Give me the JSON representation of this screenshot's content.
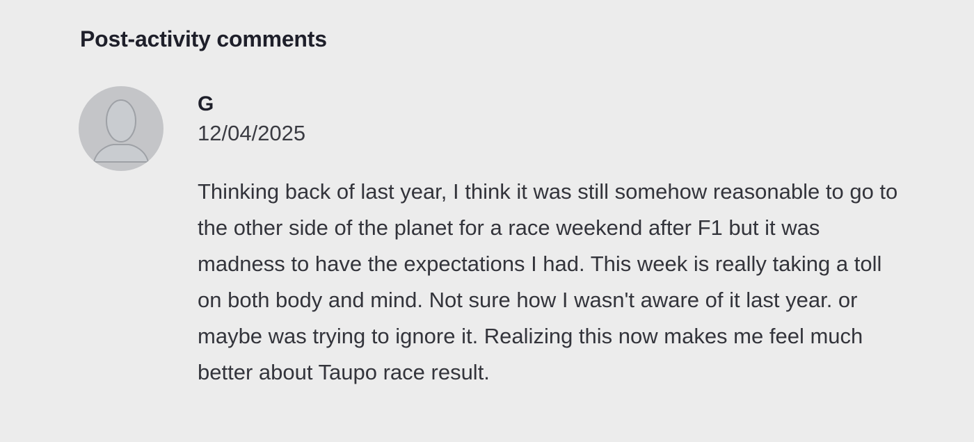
{
  "section": {
    "title": "Post-activity comments"
  },
  "comment": {
    "avatar_icon": "default-user-avatar",
    "author": "G",
    "date": "12/04/2025",
    "text": "Thinking back of last year, I think it was still somehow reasonable to go to the other side of the planet for a race weekend after F1 but it was madness to have the expectations I had. This week is really taking a toll on both body and mind. Not sure how I wasn't aware of it last year. or maybe was trying to ignore it. Realizing this now makes me feel much better about Taupo race result."
  },
  "colors": {
    "background": "#ececec",
    "avatar_bg": "#c4c5c8",
    "avatar_figure": "#c9ccd0",
    "heading": "#1e1f2a",
    "body_text": "#33343b"
  }
}
